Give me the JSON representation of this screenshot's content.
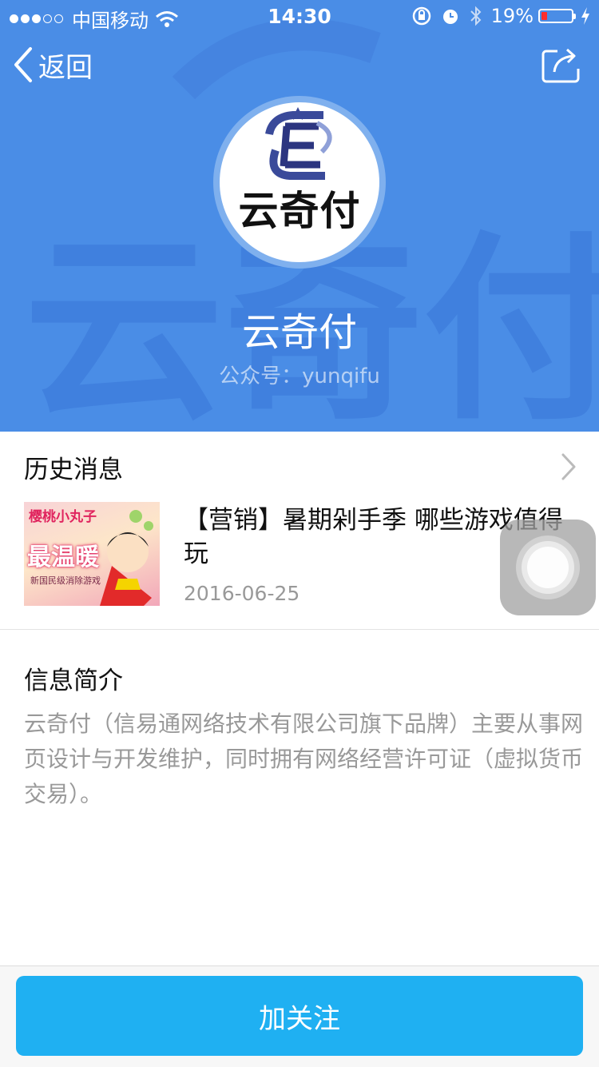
{
  "status_bar": {
    "carrier": "中国移动",
    "time": "14:30",
    "battery_percent": "19%",
    "battery_level": 0.19,
    "signal_bars_filled": 3,
    "signal_bars_total": 5
  },
  "nav": {
    "back_label": "返回"
  },
  "profile": {
    "logo_text": "云奇付",
    "name": "云奇付",
    "account_id": "公众号：yunqifu"
  },
  "history": {
    "title": "历史消息",
    "articles": [
      {
        "title": "【营销】暑期剁手季 哪些游戏值得玩",
        "date": "2016-06-25",
        "thumb_caption_top": "樱桃小丸子",
        "thumb_caption_main": "最温暖",
        "thumb_caption_sub": "新国民级消除游戏"
      }
    ]
  },
  "intro": {
    "title": "信息简介",
    "text": "云奇付（信易通网络技术有限公司旗下品牌）主要从事网页设计与开发维护，同时拥有网络经营许可证（虚拟货币交易）。"
  },
  "actions": {
    "follow_label": "加关注"
  },
  "colors": {
    "header_bg": "#4a8de6",
    "follow_button": "#1fb0f2",
    "battery_low": "#ff2d2d"
  },
  "icons": [
    "wifi-icon",
    "lock-rotation-icon",
    "alarm-icon",
    "bluetooth-icon",
    "battery-icon",
    "charging-icon",
    "back-chevron-icon",
    "share-icon",
    "chevron-right-icon"
  ]
}
